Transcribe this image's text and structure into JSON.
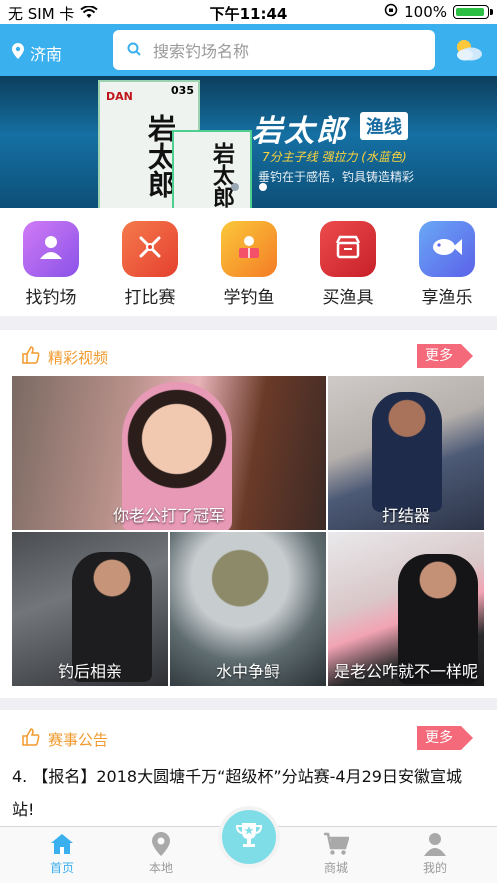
{
  "status_bar": {
    "carrier": "无 SIM 卡",
    "time": "下午11:44",
    "battery": "100%"
  },
  "top_bar": {
    "city": "济南",
    "search_placeholder": "搜索钓场名称"
  },
  "banner": {
    "pack_line_size": "035",
    "pack_brand": "DAN",
    "pack_name": "岩太郎",
    "brand_title": "岩太郎",
    "brand_tag": "渔线",
    "slogan": "7分主子线 强拉力 (水蓝色)",
    "subline": "垂钓在于感悟，钓具铸造精彩",
    "slide_count": 2,
    "active_slide": 2
  },
  "categories": [
    {
      "label": "找钓场",
      "icon": "person-icon",
      "color": "#b36ef0"
    },
    {
      "label": "打比赛",
      "icon": "crossed-rods-icon",
      "color": "#ee5a3a"
    },
    {
      "label": "学钓鱼",
      "icon": "learn-icon",
      "color": "#f7a42b"
    },
    {
      "label": "买渔具",
      "icon": "shop-icon",
      "color": "#e4363b"
    },
    {
      "label": "享渔乐",
      "icon": "fish-icon",
      "color": "#5f87f1"
    }
  ],
  "videos_section": {
    "title": "精彩视频",
    "more": "更多",
    "videos": [
      {
        "caption": "你老公打了冠军"
      },
      {
        "caption": "打结器"
      },
      {
        "caption": "钓后相亲"
      },
      {
        "caption": "水中争鲟"
      },
      {
        "caption": "是老公咋就不一样呢"
      }
    ]
  },
  "notice_section": {
    "title": "赛事公告",
    "more": "更多",
    "items": [
      {
        "text": "4. 【报名】2018大圆塘千万“超级杯”分站赛-4月29日安徽宣城站!"
      }
    ]
  },
  "tab_bar": {
    "tabs": [
      {
        "label": "首页",
        "icon": "home-icon",
        "active": true
      },
      {
        "label": "本地",
        "icon": "location-pin-icon",
        "active": false
      },
      {
        "label": "商城",
        "icon": "cart-icon",
        "active": false
      },
      {
        "label": "我的",
        "icon": "user-icon",
        "active": false
      }
    ],
    "center_icon": "trophy-icon"
  },
  "colors": {
    "primary": "#3ab0ee",
    "accent": "#f29a2e",
    "more_badge": "#f46a7b"
  }
}
